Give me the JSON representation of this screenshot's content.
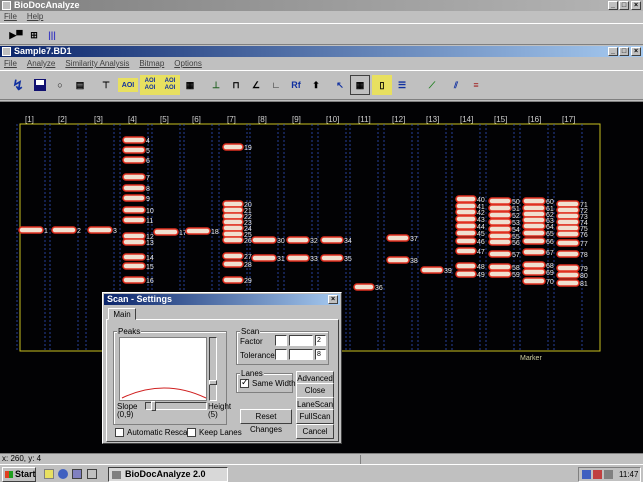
{
  "app": {
    "title": "BioDocAnalyze",
    "menu": [
      "File",
      "Help"
    ]
  },
  "doc": {
    "title": "Sample7.BD1",
    "menu": [
      "File",
      "Analyze",
      "Similarity Analysis",
      "Bitmap",
      "Options"
    ]
  },
  "toolbar_labels": {
    "aoi1": "AOI",
    "aoi2": "AOI\nAOI",
    "aoi3": "AOI\nAOI",
    "rf": "Rf"
  },
  "lanes": [
    "[1]",
    "[2]",
    "[3]",
    "[4]",
    "[5]",
    "[6]",
    "[7]",
    "[8]",
    "[9]",
    "[10]",
    "[11]",
    "[12]",
    "[13]",
    "[14]",
    "[15]",
    "[16]",
    "[17]"
  ],
  "marker_label": "Marker",
  "band_labels": {
    "l1": "1",
    "l2": "2",
    "l3": "3",
    "l4": [
      "4",
      "5",
      "6",
      "7",
      "8",
      "9",
      "10",
      "11",
      "12",
      "13",
      "14",
      "15",
      "16"
    ],
    "l5": "17",
    "l6": "18",
    "l7": [
      "19",
      "20",
      "21",
      "22",
      "23",
      "24",
      "25",
      "26",
      "27",
      "28",
      "29"
    ],
    "l8": [
      "30",
      "31"
    ],
    "l9": [
      "32",
      "33"
    ],
    "l10": [
      "34",
      "35"
    ],
    "l11": "36",
    "l12": [
      "37",
      "38"
    ],
    "l13": "39",
    "l14": [
      "40",
      "41",
      "42",
      "43",
      "44",
      "45",
      "46",
      "47",
      "48",
      "49"
    ],
    "l15": [
      "50",
      "51",
      "52",
      "53",
      "54",
      "55",
      "56",
      "57",
      "58",
      "59"
    ],
    "l16": [
      "60",
      "61",
      "62",
      "63",
      "64",
      "65",
      "66",
      "67",
      "68",
      "69",
      "70"
    ],
    "l17": [
      "71",
      "72",
      "73",
      "74",
      "75",
      "76",
      "77",
      "78",
      "79",
      "80",
      "81"
    ]
  },
  "status": {
    "coords": "x: 260, y: 4"
  },
  "dialog": {
    "title": "Scan - Settings",
    "tab": "Main",
    "peaks_label": "Peaks",
    "slope_label": "Slope\n(0,9)",
    "height_label": "Height\n(5)",
    "auto_rescan": "Automatic Rescan",
    "keep_lanes": "Keep Lanes",
    "scan_label": "Scan",
    "factor_label": "Factor",
    "factor_value": "2",
    "tolerance_label": "Tolerance",
    "tolerance_value": "8",
    "lanes_group": "Lanes",
    "same_width": "Same Width",
    "advanced": "Advanced",
    "close": "Close",
    "reset_changes": "Reset Changes",
    "lanescan": "LaneScan",
    "fullscan": "FullScan",
    "cancel": "Cancel"
  },
  "taskbar": {
    "start": "Start",
    "task": "BioDocAnalyze 2.0",
    "clock": "11:47"
  }
}
